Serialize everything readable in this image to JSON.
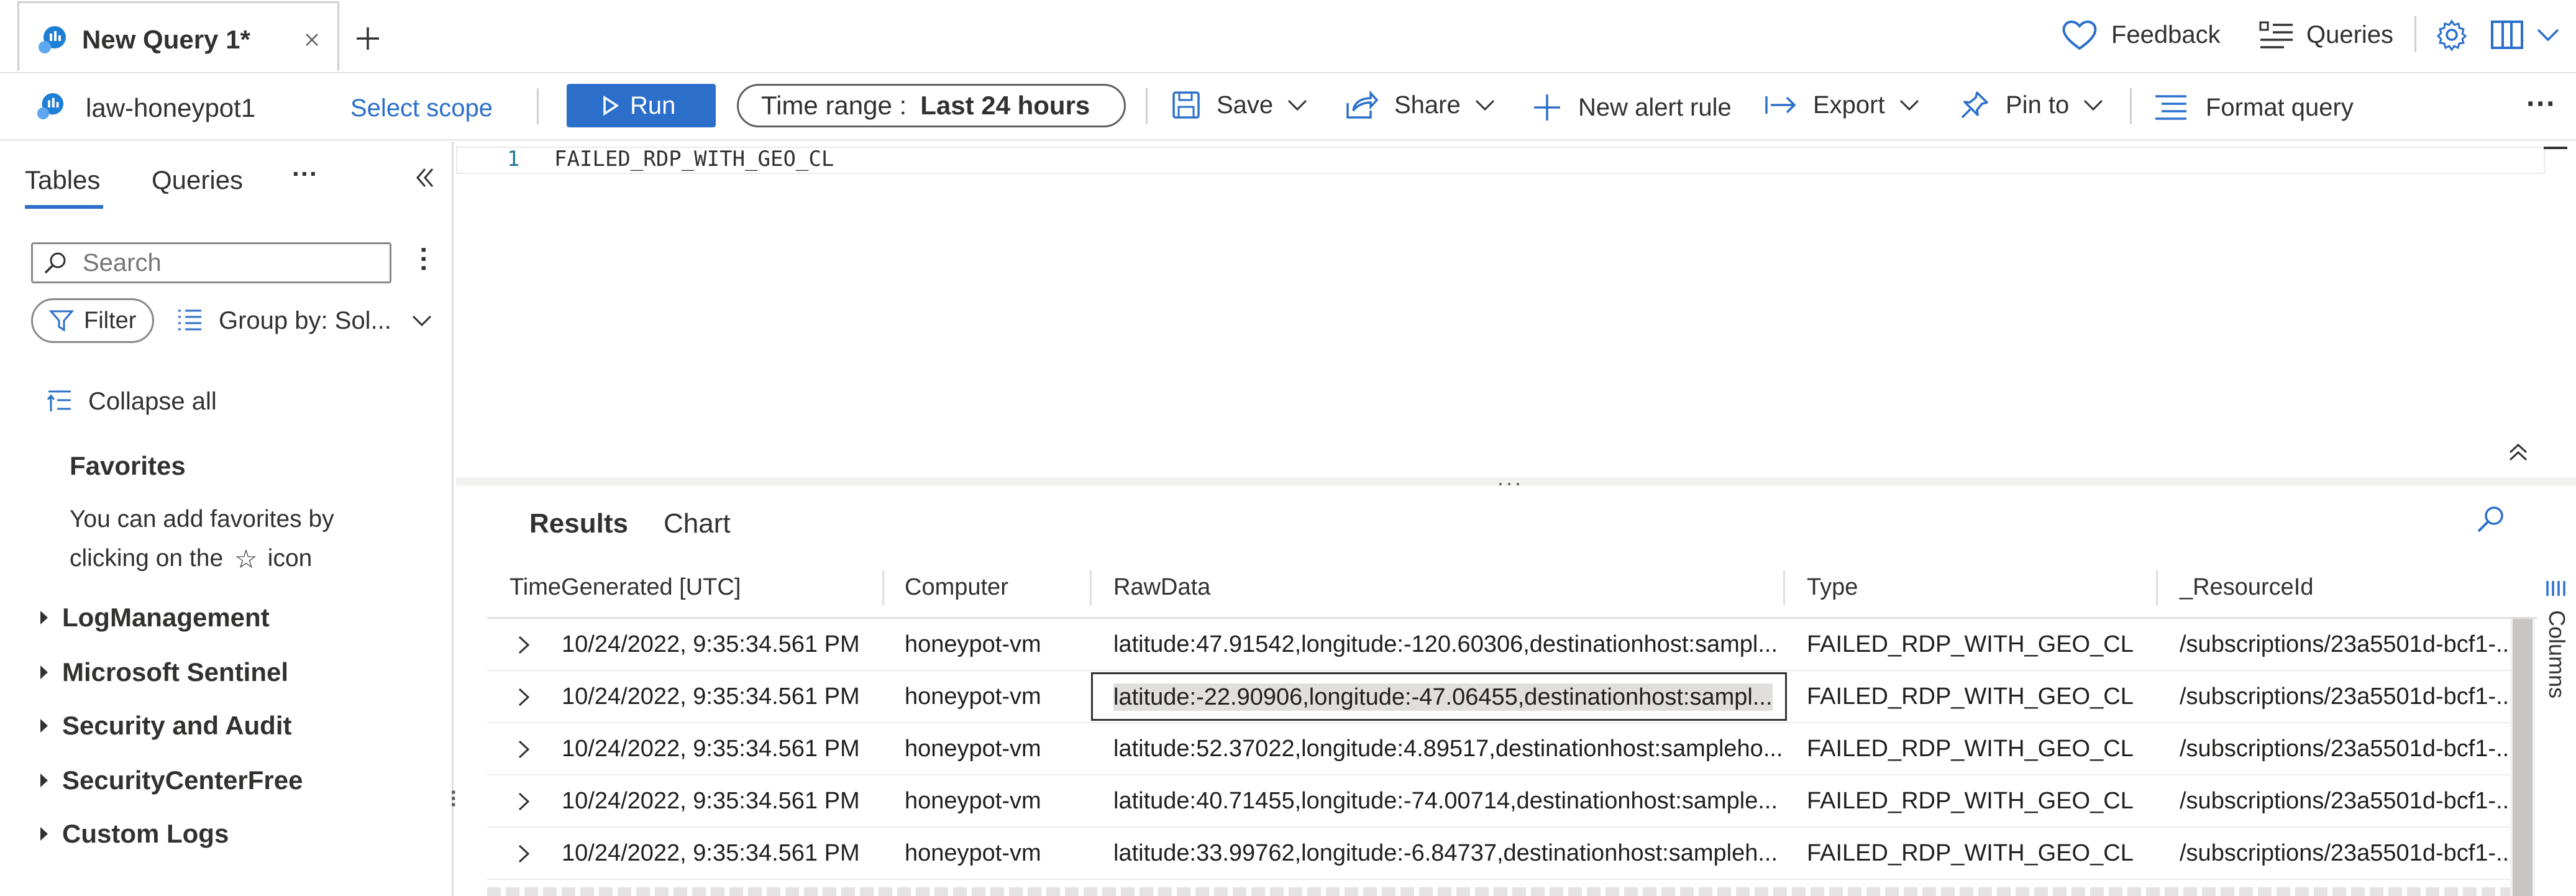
{
  "tabbar": {
    "tab_title": "New Query 1*",
    "feedback_label": "Feedback",
    "queries_label": "Queries"
  },
  "commandbar": {
    "workspace": "law-honeypot1",
    "select_scope": "Select scope",
    "run_label": "Run",
    "time_range_prefix": "Time range :",
    "time_range_value": "Last 24 hours",
    "save_label": "Save",
    "share_label": "Share",
    "new_alert_label": "New alert rule",
    "export_label": "Export",
    "pin_label": "Pin to",
    "format_label": "Format query",
    "more_label": "···"
  },
  "leftpanel": {
    "tabs": [
      "Tables",
      "Queries"
    ],
    "more_label": "···",
    "search_placeholder": "Search",
    "filter_label": "Filter",
    "group_by_label": "Group by: Sol...",
    "collapse_all": "Collapse all",
    "favorites_title": "Favorites",
    "favorites_hint_1": "You can add favorites by",
    "favorites_hint_2": "clicking on the",
    "favorites_hint_star": "☆",
    "favorites_hint_3": "icon",
    "tree_items": [
      "LogManagement",
      "Microsoft Sentinel",
      "Security and Audit",
      "SecurityCenterFree",
      "Custom Logs"
    ]
  },
  "editor": {
    "line_number": "1",
    "query_text": "FAILED_RDP_WITH_GEO_CL",
    "splitter_label": "..."
  },
  "results": {
    "tabs": [
      "Results",
      "Chart"
    ],
    "columns_label": "Columns",
    "headers": [
      "TimeGenerated [UTC]",
      "Computer",
      "RawData",
      "Type",
      "_ResourceId"
    ],
    "rows": [
      [
        "10/24/2022, 9:35:34.561 PM",
        "honeypot-vm",
        "latitude:47.91542,longitude:-120.60306,destinationhost:sampl...",
        "FAILED_RDP_WITH_GEO_CL",
        "/subscriptions/23a5501d-bcf1-..."
      ],
      [
        "10/24/2022, 9:35:34.561 PM",
        "honeypot-vm",
        "latitude:-22.90906,longitude:-47.06455,destinationhost:sampl...",
        "FAILED_RDP_WITH_GEO_CL",
        "/subscriptions/23a5501d-bcf1-..."
      ],
      [
        "10/24/2022, 9:35:34.561 PM",
        "honeypot-vm",
        "latitude:52.37022,longitude:4.89517,destinationhost:sampleho...",
        "FAILED_RDP_WITH_GEO_CL",
        "/subscriptions/23a5501d-bcf1-..."
      ],
      [
        "10/24/2022, 9:35:34.561 PM",
        "honeypot-vm",
        "latitude:40.71455,longitude:-74.00714,destinationhost:sample...",
        "FAILED_RDP_WITH_GEO_CL",
        "/subscriptions/23a5501d-bcf1-..."
      ],
      [
        "10/24/2022, 9:35:34.561 PM",
        "honeypot-vm",
        "latitude:33.99762,longitude:-6.84737,destinationhost:sampleh...",
        "FAILED_RDP_WITH_GEO_CL",
        "/subscriptions/23a5501d-bcf1-..."
      ]
    ]
  },
  "colors": {
    "accent": "#2b6fcb",
    "icon_blue": "#0f6cbd",
    "selected_cell_bg": "#e1dfdd"
  }
}
